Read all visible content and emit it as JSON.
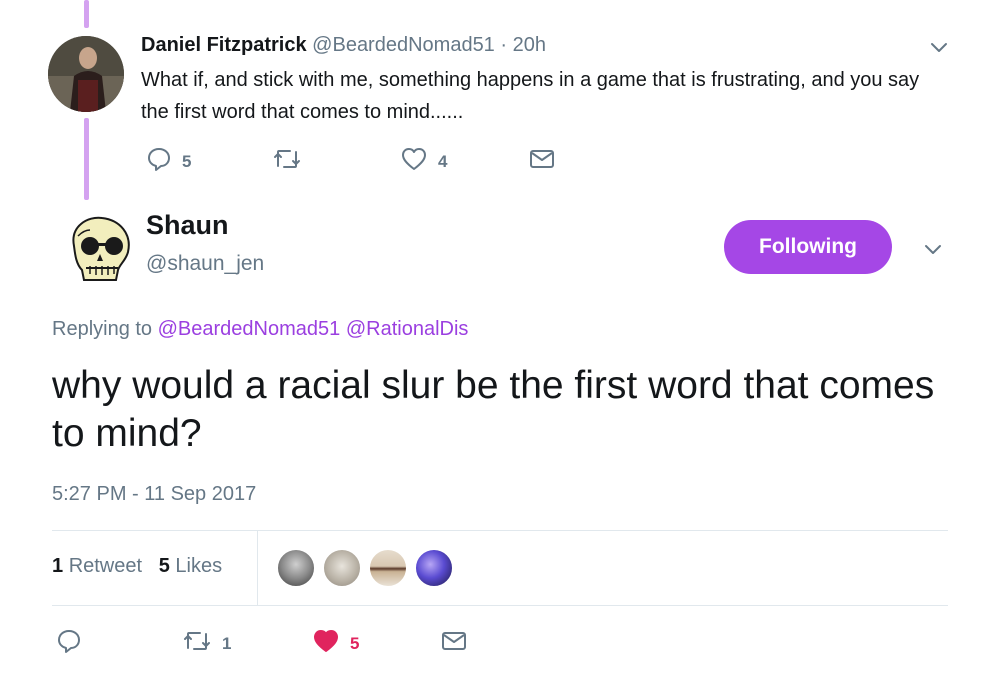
{
  "parent_tweet": {
    "author_name": "Daniel Fitzpatrick",
    "author_handle": "@BeardedNomad51",
    "separator": "·",
    "time_ago": "20h",
    "text": "What if, and stick with me, something happens in a game that is frustrating, and you say the first word that comes to mind......",
    "actions": {
      "reply_icon": "reply-icon",
      "reply_count": "5",
      "retweet_icon": "retweet-icon",
      "retweet_count": "",
      "like_icon": "heart-icon",
      "like_count": "4",
      "dm_icon": "envelope-icon"
    }
  },
  "main_tweet": {
    "author_name": "Shaun",
    "author_handle": "@shaun_jen",
    "follow_label": "Following",
    "replying_prefix": "Replying to",
    "mentions": [
      "@BeardedNomad51",
      "@RationalDis"
    ],
    "text": "why would a racial slur be the first word that comes to mind?",
    "timestamp": "5:27 PM - 11 Sep 2017",
    "stats": {
      "retweets_count": "1",
      "retweets_label": "Retweet",
      "likes_count": "5",
      "likes_label": "Likes"
    },
    "actions": {
      "reply_icon": "reply-icon",
      "retweet_icon": "retweet-icon",
      "retweet_count": "1",
      "like_icon": "heart-filled-icon",
      "like_count": "5",
      "dm_icon": "envelope-icon"
    }
  },
  "colors": {
    "accent": "#a547e6",
    "mention": "#9b3fe0",
    "thread_line": "#d4a2f0",
    "like_active": "#e0245e",
    "muted": "#657786"
  }
}
